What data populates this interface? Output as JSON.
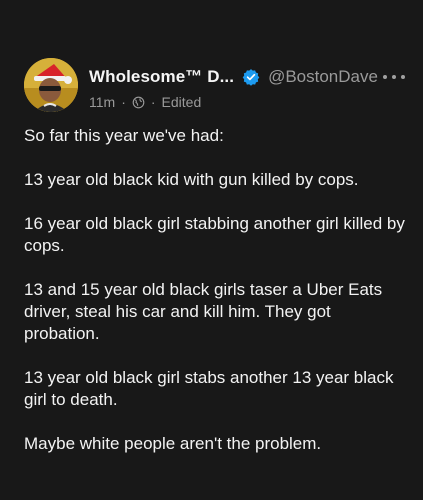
{
  "author": {
    "display_name": "Wholesome™ D...",
    "handle": "@BostonDave",
    "verified": true
  },
  "meta": {
    "time": "11m",
    "separator": "·",
    "edited": "Edited"
  },
  "post": {
    "paragraphs": [
      "So far this year we've had:",
      "13 year old black kid with gun killed by cops.",
      "16 year old black girl stabbing another girl killed by cops.",
      "13 and 15 year old black girls taser a Uber Eats driver, steal his car and kill him. They got probation.",
      "13 year old black girl stabs another 13 year black girl to death.",
      "Maybe white people aren't the problem."
    ]
  },
  "icons": {
    "verified": "verified-check-icon",
    "more": "more-dots-icon",
    "globe": "globe-icon"
  },
  "colors": {
    "background": "#181818",
    "verified": "#1d9bf0",
    "muted": "#9a9a9a"
  }
}
